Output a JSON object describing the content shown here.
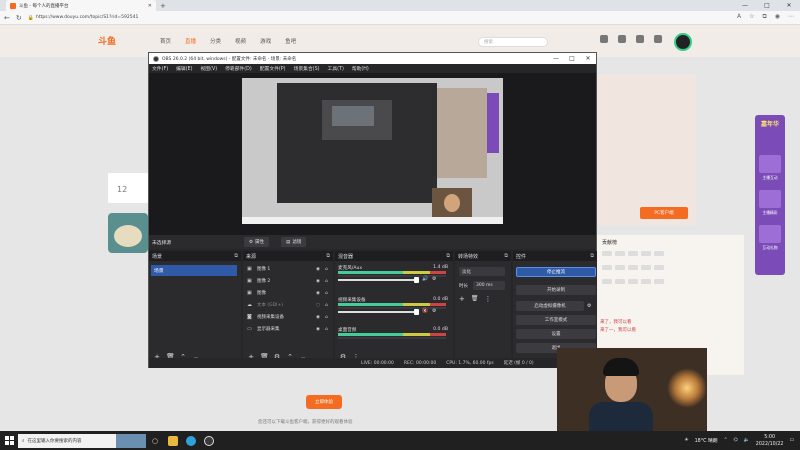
{
  "browser": {
    "tab_title": "斗鱼 - 每个人的直播平台",
    "url": "https://www.douyu.com/topic/S1?rid=592541",
    "window_controls": [
      "—",
      "□",
      "✕"
    ]
  },
  "site": {
    "logo": "斗鱼",
    "nav": [
      "首页",
      "直播",
      "分类",
      "视频",
      "游戏",
      "鱼吧"
    ],
    "search_placeholder": "搜索",
    "pc_client_label": "PC客户端",
    "left_number": "12",
    "side_ad_title": "嘉年华",
    "side_ad_items": [
      "主播互动",
      "主播精彩",
      "互动礼物"
    ],
    "rank_header": "贡献榜",
    "chat_lines": [
      "来了，我可以看",
      "来了一，我可以看"
    ],
    "bottom_button": "立即体验",
    "bottom_text": "您还可以下载斗鱼客户端，获得更好的观看体验"
  },
  "obs": {
    "title": "OBS 26.0.2 (64 bit, windows) - 配置文件: 未命名 - 场景: 未命名",
    "menu": [
      "文件(F)",
      "编辑(E)",
      "视图(V)",
      "停靠部件(D)",
      "配置文件(P)",
      "场景集合(S)",
      "工具(T)",
      "帮助(H)"
    ],
    "current_scene_label": "未选择源",
    "properties_button": "属性",
    "filters_button": "滤镜",
    "docks": {
      "scenes": {
        "title": "场景",
        "items": [
          "场景"
        ]
      },
      "sources": {
        "title": "来源",
        "items": [
          {
            "name": "图像 1",
            "icon": "image-icon"
          },
          {
            "name": "图像 2",
            "icon": "image-icon"
          },
          {
            "name": "图像",
            "icon": "image-icon"
          },
          {
            "name": "文本 (GDI+)",
            "icon": "text-icon"
          },
          {
            "name": "视频采集设备",
            "icon": "camera-icon"
          },
          {
            "name": "显示器采集",
            "icon": "monitor-icon"
          }
        ]
      },
      "mixer": {
        "title": "混音器",
        "channels": [
          {
            "name": "麦克风/Aux",
            "db": "1.4 dB"
          },
          {
            "name": "视频采集设备",
            "db": "0.0 dB"
          },
          {
            "name": "桌面音频",
            "db": "0.0 dB"
          }
        ]
      },
      "transitions": {
        "title": "转场特效",
        "type": "淡化",
        "duration_label": "时长",
        "duration_value": "300 ms"
      },
      "controls": {
        "title": "控件",
        "buttons": [
          "停止推流",
          "开始录制",
          "启动虚拟摄像机",
          "工作室模式",
          "设置",
          "退出"
        ]
      }
    },
    "status": {
      "live": "LIVE: 00:00:00",
      "rec": "REC: 00:00:00",
      "cpu": "CPU: 1.7%, 60.00 fps",
      "dropped": "延迟 (帧 0 / 0)"
    }
  },
  "taskbar": {
    "search_placeholder": "在这里输入你要搜索的内容",
    "weather": "18°C 晴朗",
    "time": "5:00",
    "date": "2022/10/22"
  },
  "colors": {
    "douyu_orange": "#f36c21",
    "obs_bg": "#262629",
    "obs_accent": "#2e5aa8"
  }
}
